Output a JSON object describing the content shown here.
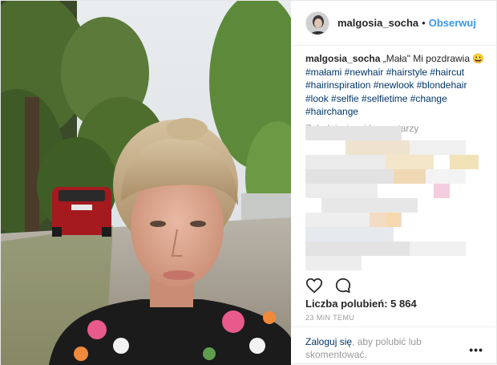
{
  "post": {
    "username": "malgosia_socha",
    "separator": "•",
    "follow_label": "Obserwuj",
    "caption_user": "malgosia_socha",
    "caption_text": " „Mała\" Mi pozdrawia 😀",
    "hashtags": "#małami #newhair #hairstyle #haircut #hairinspiration #newlook #blondehair #look #selfie #selfietime #change #hairchange",
    "load_more_label": "Załaduj więcej komentarzy",
    "likes_label": "Liczba polubień: 5 864",
    "timestamp": "23 MIN TEMU",
    "login_link": "Zaloguj się",
    "login_text": ", aby polubić lub skomentować.",
    "more_label": "•••"
  },
  "icons": {
    "like": "heart-icon",
    "comment": "comment-icon",
    "more": "more-options-icon"
  },
  "colors": {
    "link": "#3897f0",
    "hashtag": "#003569",
    "muted": "#999999"
  }
}
